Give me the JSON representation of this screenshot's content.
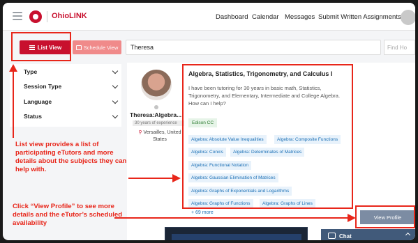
{
  "topbar": {
    "brand": "OhioLINK",
    "nav": [
      "Dashboard",
      "Calendar",
      "Messages",
      "Submit Written Assignments"
    ]
  },
  "view_buttons": {
    "list_label": "List View",
    "schedule_label": "Schedule View"
  },
  "search": {
    "value": "Theresa",
    "find_placeholder": "Find Ho"
  },
  "filters": [
    "Type",
    "Session Type",
    "Language",
    "Status"
  ],
  "tutor": {
    "name": "Theresa:Algebra...",
    "experience": "30 years of experience",
    "location_line1": "Versailles, United",
    "location_line2": "States"
  },
  "subject": {
    "title": "Algebra, Statistics, Trigonometry, and Calculus I",
    "description": "I have been tutoring for 30 years in basic math, Statistics, Trigonometry, and Elementary, Intermediate and College Algebra. How can I help?",
    "school": "Edison CC",
    "tags": [
      "Algebra: Absolute Value Inequalities",
      "Algebra: Composite Functions",
      "Algebra: Conics",
      "Algebra: Determinates of Matrices",
      "Algebra: Functional Notation",
      "Algebra: Gaussian Elimination of Matrices",
      "Algebra: Graphs of Exponentials and Logarithms",
      "Algebra: Graphs of Functions",
      "Algebra: Graphs of Lines"
    ],
    "more": "+ 69 more"
  },
  "view_profile_label": "View Profile",
  "chat_label": "Chat",
  "annotations": {
    "list_view_note": "List view provides a list of participating eTutors and more details about the subjects they can help with.",
    "view_profile_note": "Click “View Profile” to see more details and the eTutor’s scheduled availability"
  },
  "colors": {
    "brand_red": "#c8102e",
    "annotation_red": "#e8261a",
    "tag_blue": "#1a6fb5",
    "view_profile_bg": "#7c8ca3",
    "chat_bg": "#415a7a"
  }
}
